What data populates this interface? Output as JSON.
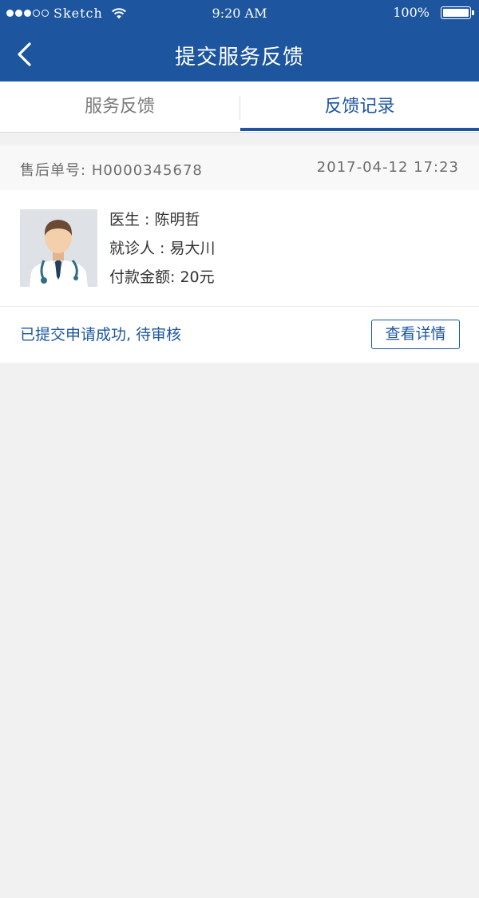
{
  "status_bar": {
    "carrier": "Sketch",
    "time": "9:20 AM",
    "battery": "100%",
    "signal_icon": "signal-dots-icon",
    "wifi_icon": "wifi-icon",
    "battery_icon": "battery-icon",
    "battery_level": 1.0
  },
  "nav": {
    "title": "提交服务反馈",
    "back_icon": "chevron-left-icon"
  },
  "tabs": [
    {
      "label": "服务反馈",
      "active": false
    },
    {
      "label": "反馈记录",
      "active": true
    }
  ],
  "order": {
    "number_label": "售后单号:",
    "number": "H0000345678",
    "datetime": "2017-04-12 17:23"
  },
  "record": {
    "avatar_icon": "doctor-avatar-icon",
    "doctor_label": "医生 :",
    "doctor_name": "陈明哲",
    "patient_label": "就诊人 :",
    "patient_name": "易大川",
    "amount_label": "付款金额:",
    "amount": "20元",
    "status": "已提交申请成功, 待审核",
    "detail_button": "查看详情"
  },
  "colors": {
    "primary": "#1d569f",
    "background": "#f1f1f1",
    "text": "#333333",
    "muted": "#7a7a7a"
  }
}
